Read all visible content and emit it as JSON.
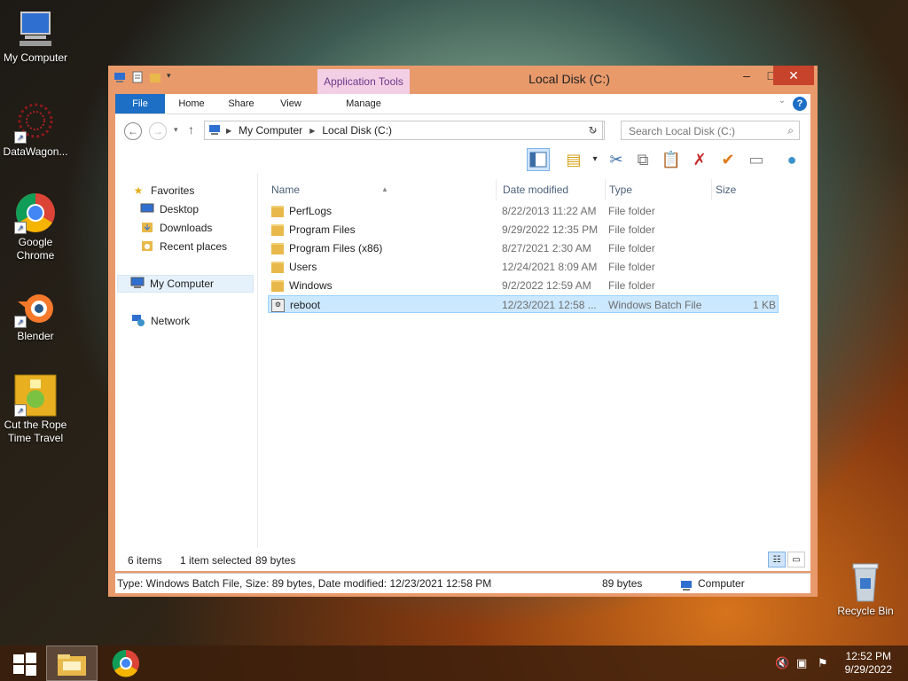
{
  "desktop": {
    "icons": [
      {
        "label": "My Computer",
        "icon": "computer-icon"
      },
      {
        "label": "DataWagon...",
        "icon": "datawagon-icon"
      },
      {
        "label": "Google Chrome",
        "icon": "chrome-icon"
      },
      {
        "label": "Blender",
        "icon": "blender-icon"
      },
      {
        "label": "Cut the Rope Time Travel",
        "icon": "game-icon"
      },
      {
        "label": "Recycle Bin",
        "icon": "recycle-bin-icon"
      }
    ]
  },
  "window": {
    "title": "Local Disk (C:)",
    "context_tab": "Application Tools",
    "tabs": [
      "File",
      "Home",
      "Share",
      "View",
      "Manage"
    ],
    "controls": {
      "minimize": "–",
      "maximize": "□",
      "close": "✕"
    },
    "address": {
      "root": "My Computer",
      "current": "Local Disk (C:)"
    },
    "search": {
      "placeholder": "Search Local Disk (C:)"
    }
  },
  "navpane": {
    "favorites": "Favorites",
    "favorite_items": [
      "Desktop",
      "Downloads",
      "Recent places"
    ],
    "my_computer": "My Computer",
    "network": "Network"
  },
  "filelist": {
    "columns": [
      "Name",
      "Date modified",
      "Type",
      "Size"
    ],
    "rows": [
      {
        "name": "PerfLogs",
        "date": "8/22/2013 11:22 AM",
        "type": "File folder",
        "size": "",
        "kind": "folder"
      },
      {
        "name": "Program Files",
        "date": "9/29/2022 12:35 PM",
        "type": "File folder",
        "size": "",
        "kind": "folder"
      },
      {
        "name": "Program Files (x86)",
        "date": "8/27/2021 2:30 AM",
        "type": "File folder",
        "size": "",
        "kind": "folder"
      },
      {
        "name": "Users",
        "date": "12/24/2021 8:09 AM",
        "type": "File folder",
        "size": "",
        "kind": "folder"
      },
      {
        "name": "Windows",
        "date": "9/2/2022 12:59 AM",
        "type": "File folder",
        "size": "",
        "kind": "folder"
      },
      {
        "name": "reboot",
        "date": "12/23/2021 12:58 ...",
        "type": "Windows Batch File",
        "size": "1 KB",
        "kind": "batch",
        "selected": true
      }
    ]
  },
  "status": {
    "item_count": "6 items",
    "selection": "1 item selected",
    "selection_size": "89 bytes"
  },
  "details": {
    "info": "Type: Windows Batch File, Size: 89 bytes, Date modified: 12/23/2021 12:58 PM",
    "size": "89 bytes",
    "location": "Computer"
  },
  "taskbar": {
    "time": "12:52 PM",
    "date": "9/29/2022"
  },
  "colors": {
    "window_frame": "#e99a6b",
    "file_tab": "#1c6fc4",
    "context_tab": "#f3cfe6",
    "selection": "#cce8ff"
  }
}
